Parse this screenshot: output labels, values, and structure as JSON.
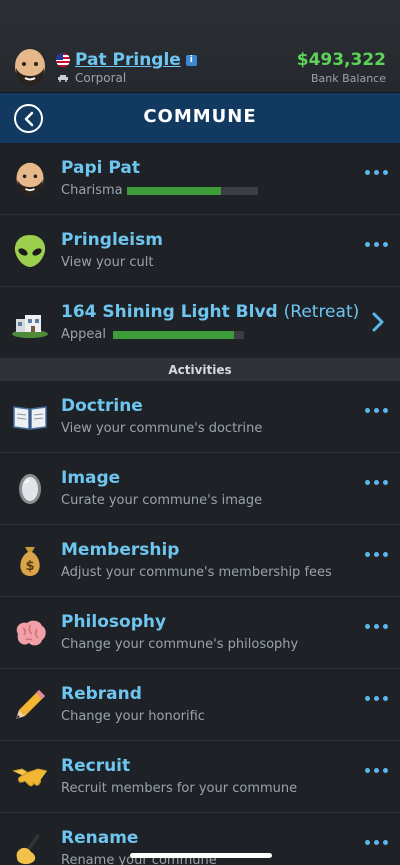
{
  "player": {
    "name": "Pat Pringle",
    "rank": "Corporal",
    "balance": "$493,322",
    "balance_label": "Bank Balance"
  },
  "title_bar": {
    "title": "COMMUNE"
  },
  "stats": [
    {
      "icon": "bald-man-face-icon",
      "name": "Papi Pat",
      "sub": "Charisma",
      "level": 0.72
    },
    {
      "icon": "alien-icon",
      "name": "Pringleism",
      "sub": "View your cult"
    },
    {
      "icon": "house-icon",
      "name": "164 Shining Light Blvd",
      "name_suffix": "(Retreat)",
      "sub": "Appeal",
      "level": 0.92
    }
  ],
  "section_header": "Activities",
  "activities": [
    {
      "icon": "open-book-icon",
      "name": "Doctrine",
      "sub": "View your commune's doctrine"
    },
    {
      "icon": "mirror-icon",
      "name": "Image",
      "sub": "Curate your commune's image"
    },
    {
      "icon": "money-bag-icon",
      "name": "Membership",
      "sub": "Adjust your commune's membership fees"
    },
    {
      "icon": "brain-icon",
      "name": "Philosophy",
      "sub": "Change your commune's philosophy"
    },
    {
      "icon": "pencil-icon",
      "name": "Rebrand",
      "sub": "Change your honorific"
    },
    {
      "icon": "handshake-icon",
      "name": "Recruit",
      "sub": "Recruit members for your commune"
    },
    {
      "icon": "writing-hand-icon",
      "name": "Rename",
      "sub": "Rename your commune"
    }
  ]
}
